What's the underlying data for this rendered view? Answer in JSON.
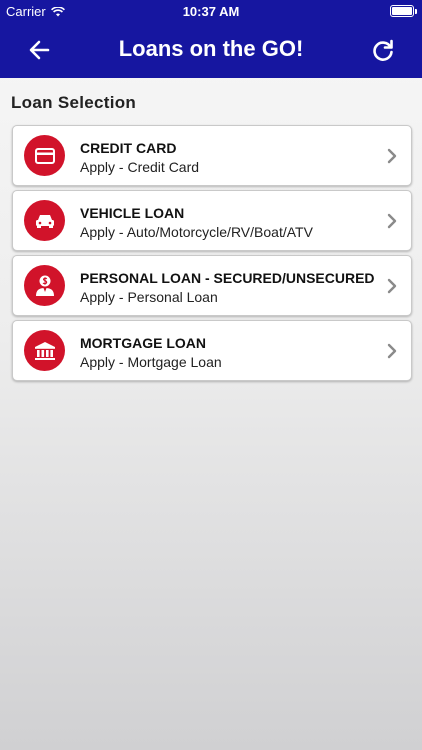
{
  "status_bar": {
    "carrier": "Carrier",
    "time": "10:37 AM"
  },
  "header": {
    "title": "Loans on the GO!",
    "back_icon": "arrow-left-icon",
    "refresh_icon": "refresh-icon"
  },
  "section": {
    "title": "Loan Selection"
  },
  "loans": [
    {
      "name": "CREDIT CARD",
      "subtitle": "Apply - Credit Card",
      "icon": "credit-card-icon"
    },
    {
      "name": "VEHICLE LOAN",
      "subtitle": "Apply - Auto/Motorcycle/RV/Boat/ATV",
      "icon": "car-icon"
    },
    {
      "name": "PERSONAL LOAN - SECURED/UNSECURED",
      "subtitle": "Apply - Personal Loan",
      "icon": "person-dollar-icon"
    },
    {
      "name": "MORTGAGE LOAN",
      "subtitle": "Apply - Mortgage Loan",
      "icon": "bank-icon"
    }
  ],
  "colors": {
    "header_bg": "#1616a0",
    "icon_badge": "#d1132a"
  }
}
